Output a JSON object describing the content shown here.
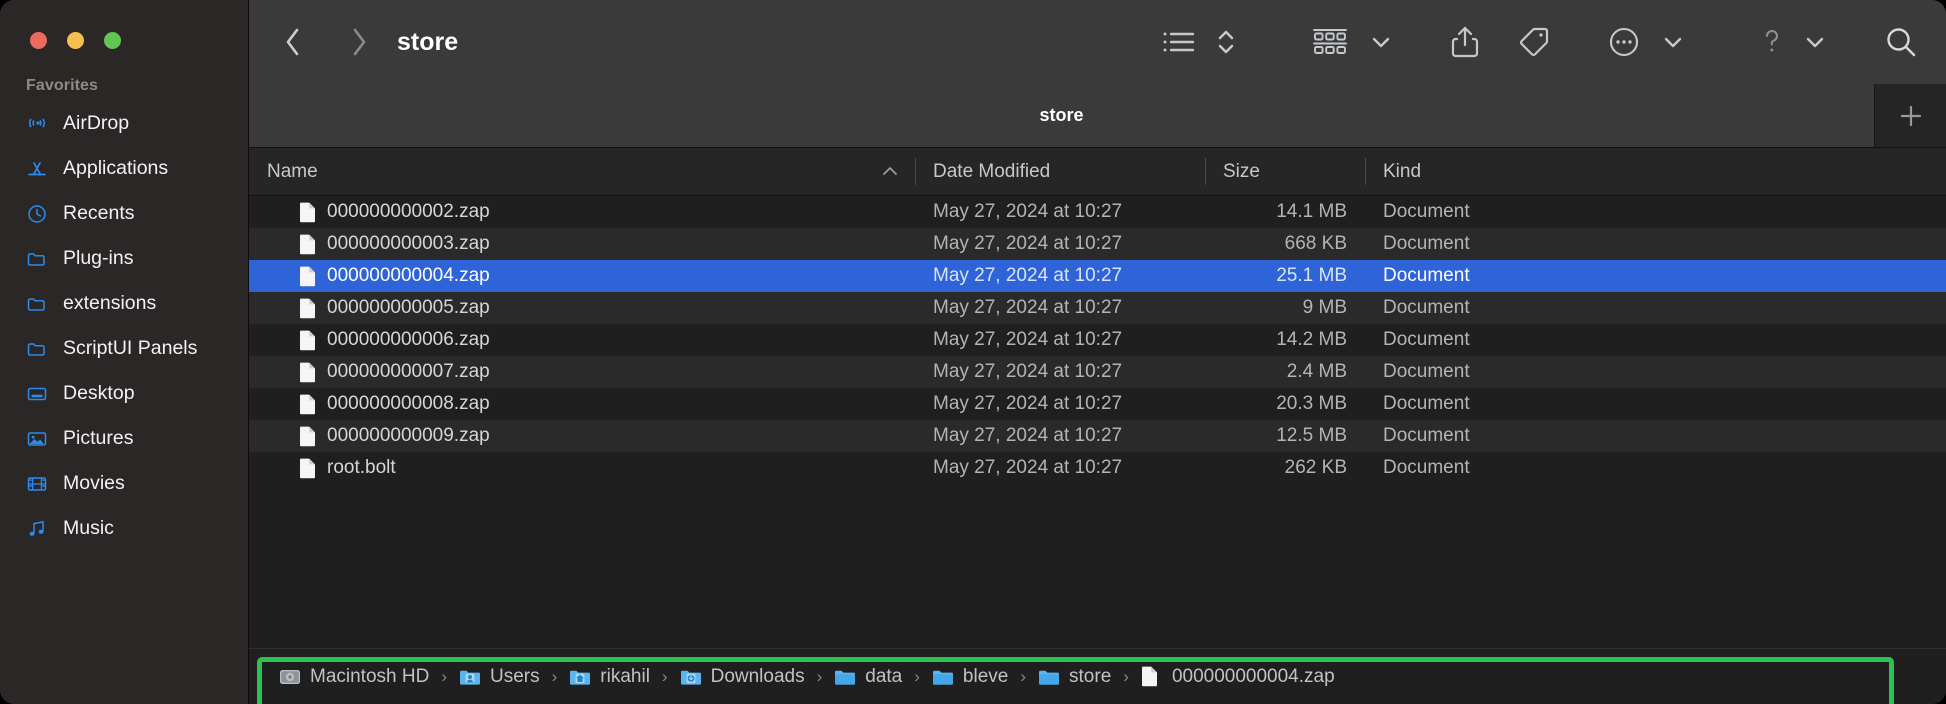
{
  "window": {
    "traffic_lights": [
      {
        "name": "close",
        "color": "#ec6a5f"
      },
      {
        "name": "minimize",
        "color": "#f3bf4f"
      },
      {
        "name": "maximize",
        "color": "#61c554"
      }
    ]
  },
  "sidebar": {
    "section_title": "Favorites",
    "items": [
      {
        "label": "AirDrop",
        "icon": "airdrop-icon"
      },
      {
        "label": "Applications",
        "icon": "applications-icon"
      },
      {
        "label": "Recents",
        "icon": "clock-icon"
      },
      {
        "label": "Plug-ins",
        "icon": "folder-icon"
      },
      {
        "label": "extensions",
        "icon": "folder-icon"
      },
      {
        "label": "ScriptUI Panels",
        "icon": "folder-icon"
      },
      {
        "label": "Desktop",
        "icon": "desktop-icon"
      },
      {
        "label": "Pictures",
        "icon": "pictures-icon"
      },
      {
        "label": "Movies",
        "icon": "movies-icon"
      },
      {
        "label": "Music",
        "icon": "music-icon"
      }
    ]
  },
  "toolbar": {
    "back_label": "‹",
    "forward_label": "›",
    "title": "store",
    "buttons": [
      {
        "name": "view-list-button",
        "icon": "list-view-icon"
      },
      {
        "name": "view-options-button",
        "icon": "chevron-up-down-icon"
      },
      {
        "name": "group-by-button",
        "icon": "group-grid-icon"
      },
      {
        "name": "group-by-dropdown",
        "icon": "chevron-down-icon"
      },
      {
        "name": "share-button",
        "icon": "share-icon"
      },
      {
        "name": "tag-button",
        "icon": "tag-icon"
      },
      {
        "name": "more-actions-button",
        "icon": "ellipsis-circle-icon"
      },
      {
        "name": "more-actions-dropdown",
        "icon": "chevron-down-icon"
      },
      {
        "name": "help-button",
        "icon": "question-mark-icon"
      },
      {
        "name": "help-dropdown",
        "icon": "chevron-down-icon"
      },
      {
        "name": "search-button",
        "icon": "search-icon"
      }
    ]
  },
  "tabbar": {
    "active_tab": "store",
    "new_tab_label": "+"
  },
  "columns": [
    {
      "key": "name",
      "label": "Name",
      "sorted": true,
      "sort_direction": "ascending"
    },
    {
      "key": "date",
      "label": "Date Modified"
    },
    {
      "key": "size",
      "label": "Size"
    },
    {
      "key": "kind",
      "label": "Kind"
    }
  ],
  "files": [
    {
      "name": "000000000002.zap",
      "date": "May 27, 2024 at 10:27",
      "size": "14.1 MB",
      "kind": "Document",
      "selected": false
    },
    {
      "name": "000000000003.zap",
      "date": "May 27, 2024 at 10:27",
      "size": "668 KB",
      "kind": "Document",
      "selected": false
    },
    {
      "name": "000000000004.zap",
      "date": "May 27, 2024 at 10:27",
      "size": "25.1 MB",
      "kind": "Document",
      "selected": true
    },
    {
      "name": "000000000005.zap",
      "date": "May 27, 2024 at 10:27",
      "size": "9 MB",
      "kind": "Document",
      "selected": false
    },
    {
      "name": "000000000006.zap",
      "date": "May 27, 2024 at 10:27",
      "size": "14.2 MB",
      "kind": "Document",
      "selected": false
    },
    {
      "name": "000000000007.zap",
      "date": "May 27, 2024 at 10:27",
      "size": "2.4 MB",
      "kind": "Document",
      "selected": false
    },
    {
      "name": "000000000008.zap",
      "date": "May 27, 2024 at 10:27",
      "size": "20.3 MB",
      "kind": "Document",
      "selected": false
    },
    {
      "name": "000000000009.zap",
      "date": "May 27, 2024 at 10:27",
      "size": "12.5 MB",
      "kind": "Document",
      "selected": false
    },
    {
      "name": "root.bolt",
      "date": "May 27, 2024 at 10:27",
      "size": "262 KB",
      "kind": "Document",
      "selected": false
    }
  ],
  "pathbar": {
    "separator": "›",
    "crumbs": [
      {
        "label": "Macintosh HD",
        "icon": "hard-drive-icon"
      },
      {
        "label": "Users",
        "icon": "users-folder-icon"
      },
      {
        "label": "rikahil",
        "icon": "home-folder-icon"
      },
      {
        "label": "Downloads",
        "icon": "downloads-folder-icon"
      },
      {
        "label": "data",
        "icon": "folder-icon"
      },
      {
        "label": "bleve",
        "icon": "folder-icon"
      },
      {
        "label": "store",
        "icon": "folder-icon"
      },
      {
        "label": "000000000004.zap",
        "icon": "document-icon"
      }
    ],
    "highlight_color": "#2dc14f"
  },
  "colors": {
    "selection_blue": "#2f63d8",
    "sidebar_bg": "#2a2726",
    "toolbar_bg": "#3a3a3a",
    "content_bg": "#1f1f1f",
    "accent_icon_blue": "#2b8cf0"
  }
}
